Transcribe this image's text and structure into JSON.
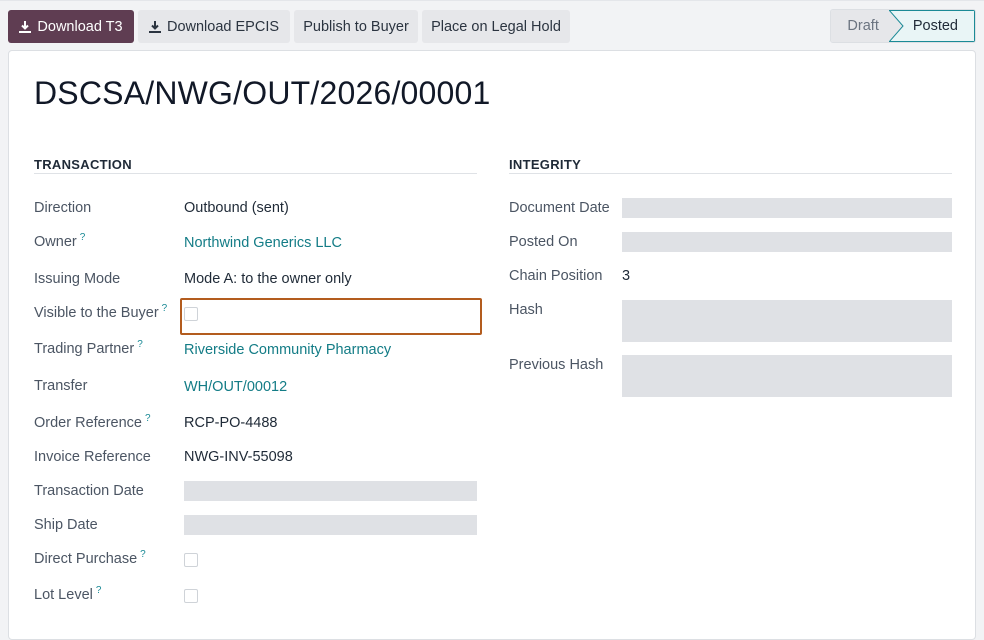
{
  "toolbar": {
    "download_t3": "Download T3",
    "download_epcis": "Download EPCIS",
    "publish": "Publish to Buyer",
    "legal_hold": "Place on Legal Hold"
  },
  "status": {
    "draft": "Draft",
    "posted": "Posted",
    "active": "Posted"
  },
  "record": {
    "title": "DSCSA/NWG/OUT/2026/00001"
  },
  "transaction": {
    "heading": "TRANSACTION",
    "direction_label": "Direction",
    "direction_value": "Outbound (sent)",
    "owner_label": "Owner",
    "owner_value": "Northwind Generics LLC",
    "issuing_mode_label": "Issuing Mode",
    "issuing_mode_value": "Mode A: to the owner only",
    "visible_label": "Visible to the Buyer",
    "visible_checked": false,
    "partner_label": "Trading Partner",
    "partner_value": "Riverside Community Pharmacy",
    "transfer_label": "Transfer",
    "transfer_value": "WH/OUT/00012",
    "order_ref_label": "Order Reference",
    "order_ref_value": "RCP-PO-4488",
    "invoice_ref_label": "Invoice Reference",
    "invoice_ref_value": "NWG-INV-55098",
    "transaction_date_label": "Transaction Date",
    "ship_date_label": "Ship Date",
    "direct_purchase_label": "Direct Purchase",
    "direct_purchase_checked": false,
    "lot_level_label": "Lot Level",
    "lot_level_checked": false
  },
  "integrity": {
    "heading": "INTEGRITY",
    "document_date_label": "Document Date",
    "posted_on_label": "Posted On",
    "chain_position_label": "Chain Position",
    "chain_position_value": "3",
    "hash_label": "Hash",
    "previous_hash_label": "Previous Hash"
  },
  "help_marker": "?",
  "colors": {
    "primary_button": "#5f3d52",
    "link": "#137c86",
    "focus_outline": "#b35c1e"
  }
}
